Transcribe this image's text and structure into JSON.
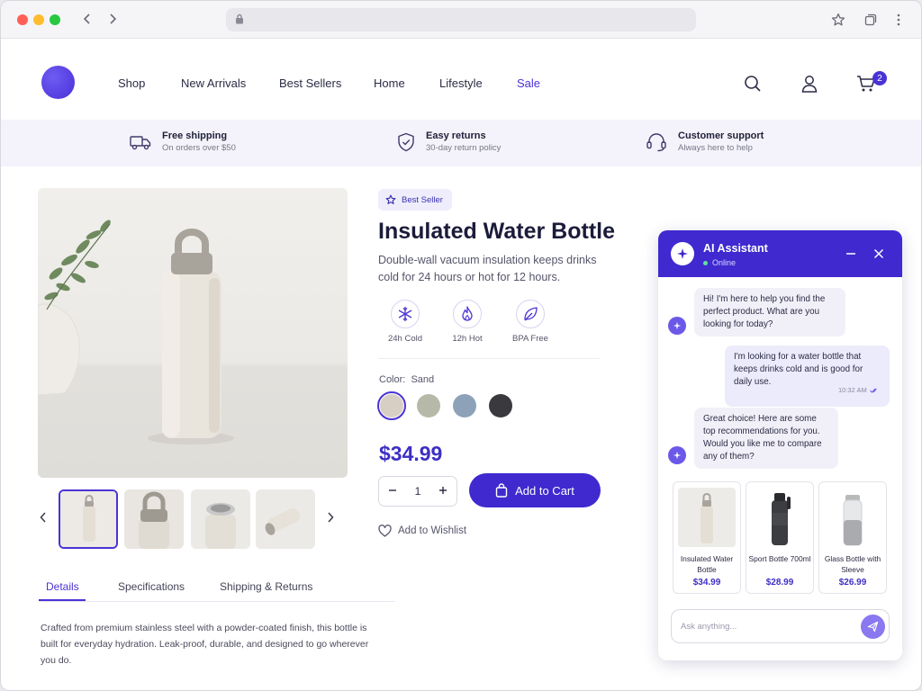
{
  "browser": {
    "url": ""
  },
  "header": {
    "nav": [
      "Shop",
      "New Arrivals",
      "Best Sellers",
      "Home",
      "Lifestyle",
      "Sale"
    ],
    "cart_count": "2"
  },
  "perks": [
    {
      "title": "Free shipping",
      "subtitle": "On orders over $50",
      "icon": "truck-icon"
    },
    {
      "title": "Easy returns",
      "subtitle": "30-day return policy",
      "icon": "shield-check-icon"
    },
    {
      "title": "Customer support",
      "subtitle": "Always here to help",
      "icon": "headset-icon"
    }
  ],
  "product": {
    "badge": "Best Seller",
    "title": "Insulated Water Bottle",
    "subtitle": "Double-wall vacuum insulation keeps drinks cold for 24 hours or hot for 12 hours.",
    "features": [
      {
        "label": "24h Cold",
        "icon": "snowflake-icon"
      },
      {
        "label": "12h Hot",
        "icon": "flame-icon"
      },
      {
        "label": "BPA Free",
        "icon": "leaf-icon"
      }
    ],
    "color_label": "Color:",
    "color_value": "Sand",
    "colors": [
      "#d8cfc4",
      "#b7b9a8",
      "#8da2b8",
      "#3a3a3e"
    ],
    "price": "$34.99",
    "quantity": "1",
    "add_to_cart": "Add to Cart",
    "wishlist": "Add to Wishlist"
  },
  "tabs": [
    "Details",
    "Specifications",
    "Shipping & Returns"
  ],
  "description": "Crafted from premium stainless steel with a powder-coated finish, this bottle is built for everyday hydration. Leak-proof, durable, and designed to go wherever you do.",
  "chat": {
    "title": "AI Assistant",
    "status": "Online",
    "messages": [
      {
        "from": "bot",
        "text": "Hi! I'm here to help you find the perfect product. What are you looking for today?"
      },
      {
        "from": "user",
        "text": "I'm looking for a water bottle that keeps drinks cold and is good for daily use.",
        "time": "10:32 AM"
      },
      {
        "from": "bot",
        "text": "Great choice! Here are some top recommendations for you. Would you like me to compare any of them?"
      }
    ],
    "recommendations": [
      {
        "name": "Insulated Water Bottle",
        "price": "$34.99"
      },
      {
        "name": "Sport Bottle 700ml",
        "price": "$28.99"
      },
      {
        "name": "Glass Bottle with Sleeve",
        "price": "$26.99"
      }
    ],
    "input_placeholder": "Ask anything..."
  }
}
